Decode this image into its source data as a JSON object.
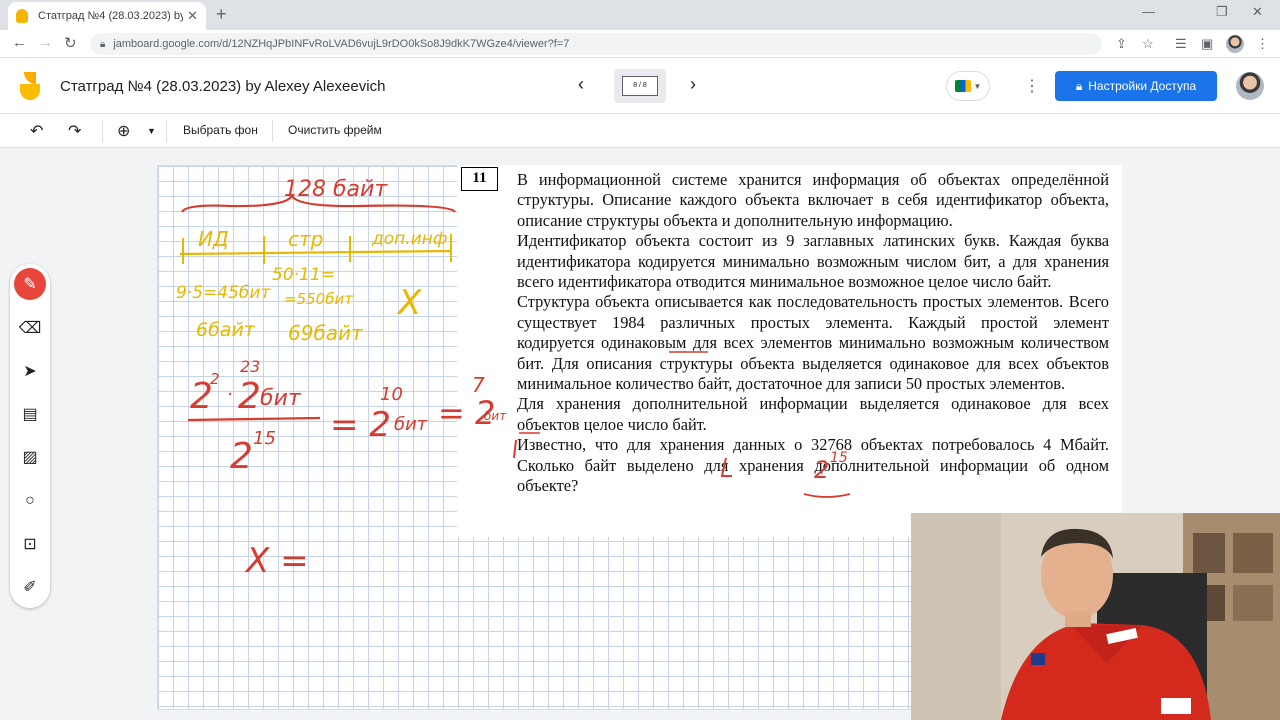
{
  "browser": {
    "tab_title": "Статград №4 (28.03.2023) by Ale",
    "url": "jamboard.google.com/d/12NZHqJPbINFvRoLVAD6vujL9rDO0kSo8J9dkK7WGze4/viewer?f=7"
  },
  "app": {
    "title": "Статград №4 (28.03.2023) by Alexey Alexeevich",
    "frame_indicator": "8 / 8",
    "share_label": "Настройки Доступа"
  },
  "toolbar": {
    "set_background": "Выбрать фон",
    "clear_frame": "Очистить фрейм"
  },
  "problem": {
    "number": "11",
    "paragraphs": [
      "В информационной системе хранится информация об объектах определённой структуры. Описание каждого объекта включает в себя идентификатор объекта, описание структуры объекта и дополнительную информацию.",
      "Идентификатор объекта состоит из 9 заглавных латинских букв. Каждая буква идентификатора кодируется минимально возможным числом бит, а для хранения всего идентификатора отводится минимальное возможное целое число байт.",
      "Структура объекта описывается как последовательность простых элементов. Всего существует 1984 различных простых элемента. Каждый простой элемент кодируется одинаковым для всех элементов минимально возможным количеством бит. Для описания структуры объекта выделяется одинаковое для всех объектов минимальное количество байт, достаточное для записи 50 простых элементов.",
      "Для хранения дополнительной информации выделяется одинаковое для всех объектов целое число байт.",
      "Известно, что для хранения данных о 32768 объектах потребовалось 4 Мбайт. Сколько байт выделено для хранения дополнительной информации об одном объекте?"
    ]
  },
  "annotations": {
    "yellow_total": "128 байт",
    "yellow_id": "ИД",
    "yellow_str": "стр",
    "yellow_dop": "доп.инф",
    "yellow_id_calc": "9·5=45бит",
    "yellow_id_bytes": "6байт",
    "yellow_str_calc": "50·11=",
    "yellow_str_bits": "=550бит",
    "yellow_str_bytes": "69байт",
    "yellow_x": "X",
    "red_formula_a": "2",
    "red_formula_a_exp": "2",
    "red_formula_b": "2",
    "red_formula_b_exp": "23",
    "red_formula_b_unit": "бит",
    "red_formula_den": "2",
    "red_formula_den_exp": "15",
    "red_eq_base": "= 2",
    "red_eq_exp": "10",
    "red_eq_unit": "бит",
    "red_eq2_base": "= 2",
    "red_eq2_exp": "7",
    "red_eq2_unit": "бит",
    "red_x": "X =",
    "red_over_32768": "2",
    "red_over_32768_exp": "15"
  },
  "colors": {
    "accent_blue": "#1a73e8",
    "pen_red": "#e8453c",
    "ink_red": "#d63b30",
    "ink_yellow": "#e6b800"
  }
}
